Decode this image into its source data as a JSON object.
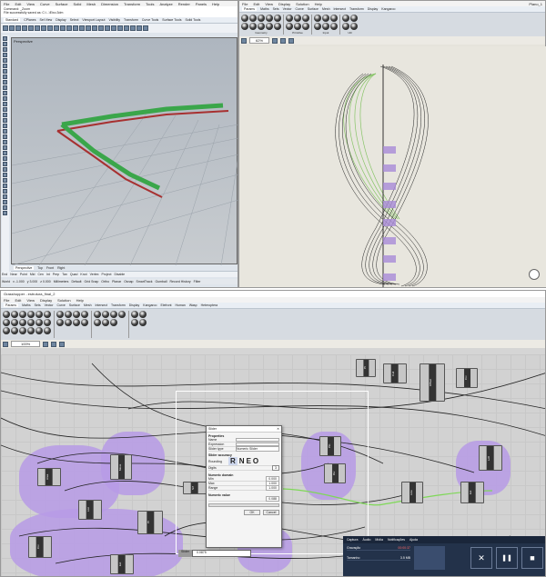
{
  "rhino": {
    "menu": [
      "File",
      "Edit",
      "View",
      "Curve",
      "Surface",
      "Solid",
      "Mesh",
      "Dimension",
      "Transform",
      "Tools",
      "Analyze",
      "Render",
      "Panels",
      "Help"
    ],
    "command_line": "Command: _Zoom",
    "path_line": "File successfully saved as: C:\\...\\Eixo.3dm",
    "tabs": [
      "Standard",
      "CPlanes",
      "Set View",
      "Display",
      "Select",
      "Viewport Layout",
      "Visibility",
      "Transform",
      "Curve Tools",
      "Surface Tools",
      "Solid Tools"
    ],
    "viewport_label": "Perspective",
    "viewport_tabs": [
      "Perspective",
      "Top",
      "Front",
      "Right"
    ],
    "osnaps": [
      "End",
      "Near",
      "Point",
      "Mid",
      "Cen",
      "Int",
      "Perp",
      "Tan",
      "Quad",
      "Knot",
      "Vertex",
      "Project",
      "Disable"
    ],
    "status": [
      "World",
      "x -1.000",
      "y 3.000",
      "z 0.000",
      "Millimeters",
      "Default",
      "Grid Snap",
      "Ortho",
      "Planar",
      "Osnap",
      "SmartTrack",
      "Gumball",
      "Record History",
      "Filter"
    ]
  },
  "gh_top": {
    "menu": [
      "File",
      "Edit",
      "View",
      "Display",
      "Solution",
      "Help"
    ],
    "title": "Plano_1",
    "tabs": [
      "Params",
      "Maths",
      "Sets",
      "Vector",
      "Curve",
      "Surface",
      "Mesh",
      "Intersect",
      "Transform",
      "Display",
      "Kangaroo"
    ],
    "zoom": "62%",
    "groups": [
      "Geometry",
      "Primitive",
      "Input",
      "Util"
    ]
  },
  "gh_bottom": {
    "title": "Grasshopper - estrutura_final_2",
    "menu": [
      "File",
      "Edit",
      "View",
      "Display",
      "Solution",
      "Help"
    ],
    "tabs": [
      "Params",
      "Maths",
      "Sets",
      "Vector",
      "Curve",
      "Surface",
      "Mesh",
      "Intersect",
      "Transform",
      "Display",
      "Kangaroo",
      "Elefront",
      "Human",
      "Wasp",
      "Heteroptera"
    ],
    "zoom": "100%",
    "nodes": [
      "Area",
      "Move",
      "List",
      "Pt",
      "Crv",
      "Ext",
      "Srf",
      "Pln",
      "Div",
      "Line",
      "Ext",
      "Offset",
      "Cull",
      "Pt",
      "Crv",
      "Loft"
    ],
    "slider_chip": "Slider",
    "slider_chip2": "0.0875",
    "dialog": {
      "title": "Slider",
      "section1": "Properties",
      "fields": [
        {
          "label": "Name",
          "value": ""
        },
        {
          "label": "Expression",
          "value": ""
        },
        {
          "label": "Slider type",
          "value": "Numeric Slider"
        }
      ],
      "section2": "Slider accuracy",
      "rounding_label": "Rounding",
      "rounding": [
        "R",
        "N",
        "E",
        "O"
      ],
      "digits_label": "Digits",
      "digits": "3",
      "section3": "Numeric domain",
      "domain": [
        {
          "label": "Min",
          "value": "0.000"
        },
        {
          "label": "Max",
          "value": "1.000"
        },
        {
          "label": "Range",
          "value": "1.000"
        }
      ],
      "section4": "Numeric value",
      "value": "0.088",
      "ok": "OK",
      "cancel": "Cancel"
    },
    "capture": {
      "tabs": [
        "Captura",
        "Áudio",
        "Mídia",
        "Notificações",
        "Ajuda"
      ],
      "rows": [
        {
          "label": "Gravação",
          "value": "00:00:37"
        },
        {
          "label": "Tamanho",
          "value": "3.5 MB"
        }
      ],
      "close": "✕",
      "pause": "❚❚",
      "stop": "■"
    }
  }
}
